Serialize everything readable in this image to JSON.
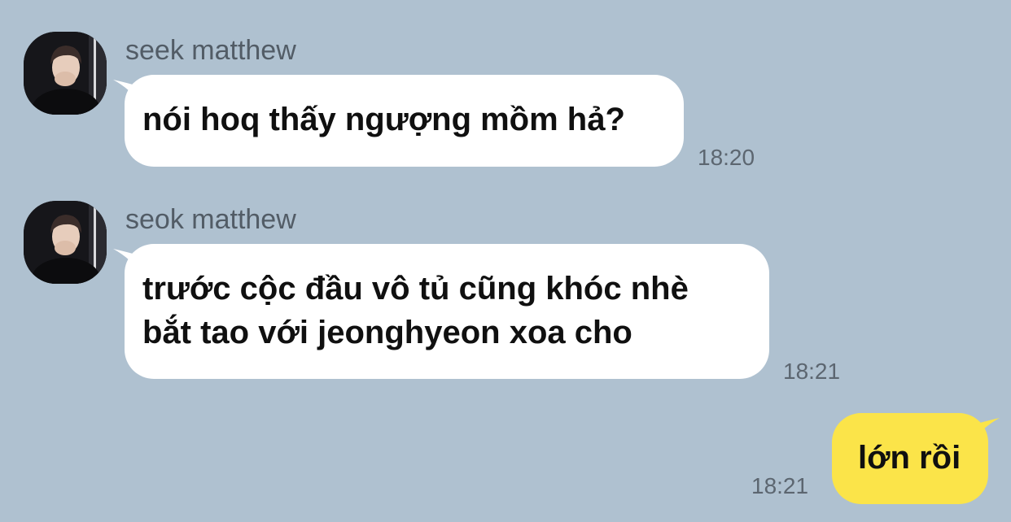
{
  "messages": [
    {
      "sender": "seek matthew",
      "text": "nói hoq thấy ngượng mồm hả?",
      "time": "18:20"
    },
    {
      "sender": "seok matthew",
      "lines": [
        "trước cộc đầu vô tủ cũng khóc nhè",
        "bắt tao với jeonghyeon xoa cho"
      ],
      "time": "18:21"
    },
    {
      "text": "lớn rồi",
      "time": "18:21"
    }
  ],
  "colors": {
    "background": "#afc1d0",
    "incoming_bubble": "#ffffff",
    "outgoing_bubble": "#fbe449",
    "sender_name": "#525c66",
    "timestamp": "#5c6670"
  },
  "icons": [
    "avatar-photo"
  ]
}
